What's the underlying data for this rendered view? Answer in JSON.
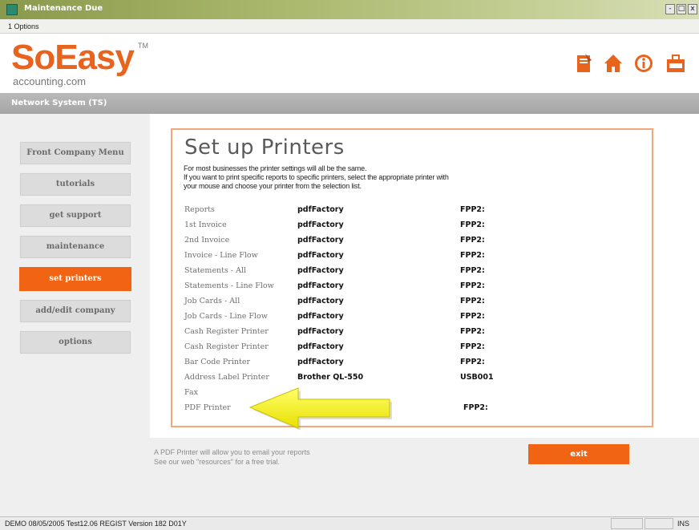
{
  "window": {
    "title": "Maintenance Due",
    "controls": {
      "minimize": "-",
      "maximize": "□",
      "close": "x"
    }
  },
  "menu": {
    "options_label": "1 Options"
  },
  "brand": {
    "name": "SoEasy",
    "tm": "TM",
    "tagline": "accounting.com",
    "accent": "#e8641e"
  },
  "header_icons": [
    "document-icon",
    "home-icon",
    "info-icon",
    "briefcase-icon"
  ],
  "subbar": {
    "system": "Network System (TS)"
  },
  "nav": {
    "items": [
      {
        "label": "Front Company Menu",
        "active": false
      },
      {
        "label": "tutorials",
        "active": false
      },
      {
        "label": "get support",
        "active": false
      },
      {
        "label": "maintenance",
        "active": false
      },
      {
        "label": "set printers",
        "active": true
      },
      {
        "label": "add/edit company",
        "active": false
      },
      {
        "label": "options",
        "active": false
      }
    ]
  },
  "printers": {
    "title": "Set up Printers",
    "intro": [
      "For most businesses the printer settings will all be the same.",
      "If you want to print specific reports to specific printers, select the appropriate printer with",
      "your mouse and choose your printer from the selection list."
    ],
    "rows": [
      {
        "label": "Reports",
        "printer": "pdfFactory",
        "port": "FPP2:"
      },
      {
        "label": "1st Invoice",
        "printer": "pdfFactory",
        "port": "FPP2:"
      },
      {
        "label": "2nd Invoice",
        "printer": "pdfFactory",
        "port": "FPP2:"
      },
      {
        "label": "Invoice - Line Flow",
        "printer": "pdfFactory",
        "port": "FPP2:"
      },
      {
        "label": "Statements - All",
        "printer": "pdfFactory",
        "port": "FPP2:"
      },
      {
        "label": "Statements - Line Flow",
        "printer": "pdfFactory",
        "port": "FPP2:"
      },
      {
        "label": "Job Cards - All",
        "printer": "pdfFactory",
        "port": "FPP2:"
      },
      {
        "label": "Job Cards - Line Flow",
        "printer": "pdfFactory",
        "port": "FPP2:"
      },
      {
        "label": "Cash Register Printer",
        "printer": "pdfFactory",
        "port": "FPP2:"
      },
      {
        "label": "Cash Register Printer",
        "printer": "pdfFactory",
        "port": "FPP2:"
      },
      {
        "label": "Bar Code Printer",
        "printer": "pdfFactory",
        "port": "FPP2:"
      },
      {
        "label": "Address Label Printer",
        "printer": "Brother QL-550",
        "port": "USB001"
      },
      {
        "label": "Fax",
        "printer": "",
        "port": ""
      },
      {
        "label": "PDF Printer",
        "printer": "",
        "port": "FPP2:"
      }
    ]
  },
  "footer": {
    "note_line1": "A PDF Printer will allow you to email your reports",
    "note_line2": "See our web \"resources\" for a free trial.",
    "exit_label": "exit"
  },
  "status": {
    "text": "DEMO  08/05/2005  Test12.06  REGIST Version     182 D01Y",
    "ins": "INS"
  }
}
